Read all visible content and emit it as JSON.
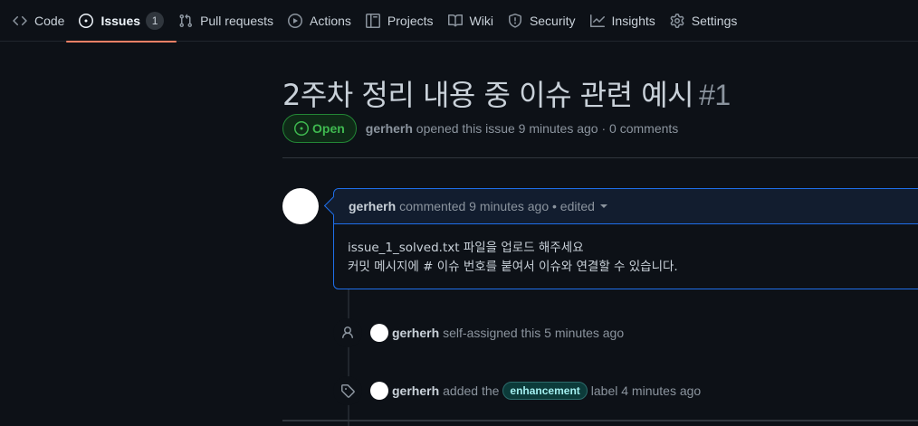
{
  "nav": {
    "tabs": [
      {
        "label": "Code",
        "icon": "code-icon"
      },
      {
        "label": "Issues",
        "icon": "issue-opened-icon",
        "count": "1",
        "selected": true
      },
      {
        "label": "Pull requests",
        "icon": "git-pull-request-icon"
      },
      {
        "label": "Actions",
        "icon": "play-icon"
      },
      {
        "label": "Projects",
        "icon": "table-icon"
      },
      {
        "label": "Wiki",
        "icon": "book-icon"
      },
      {
        "label": "Security",
        "icon": "shield-icon"
      },
      {
        "label": "Insights",
        "icon": "graph-icon"
      },
      {
        "label": "Settings",
        "icon": "gear-icon"
      }
    ]
  },
  "issue": {
    "title": "2주차 정리 내용 중 이슈 관련 예시",
    "number": "#1",
    "state": "Open",
    "author": "gerherh",
    "opened_text": "opened this issue 9 minutes ago · 0 comments"
  },
  "comment": {
    "author": "gerherh",
    "meta": "commented 9 minutes ago • edited",
    "body_line1": "issue_1_solved.txt 파일을 업로드 해주세요",
    "body_line2": "커밋 메시지에 # 이슈 번호를 붙여서 이슈와 연결할 수 있습니다."
  },
  "timeline": {
    "assign": {
      "author": "gerherh",
      "text": "self-assigned this 5 minutes ago",
      "icon": "person-icon"
    },
    "label_event": {
      "author": "gerherh",
      "text_before": "added the",
      "label": "enhancement",
      "text_after": "label 4 minutes ago",
      "icon": "tag-icon",
      "label_color": "#a2eeef"
    }
  },
  "colors": {
    "background": "#0d1117",
    "accent_tab": "#f78166",
    "open_green": "#3fb950",
    "comment_border": "#1f6feb"
  }
}
